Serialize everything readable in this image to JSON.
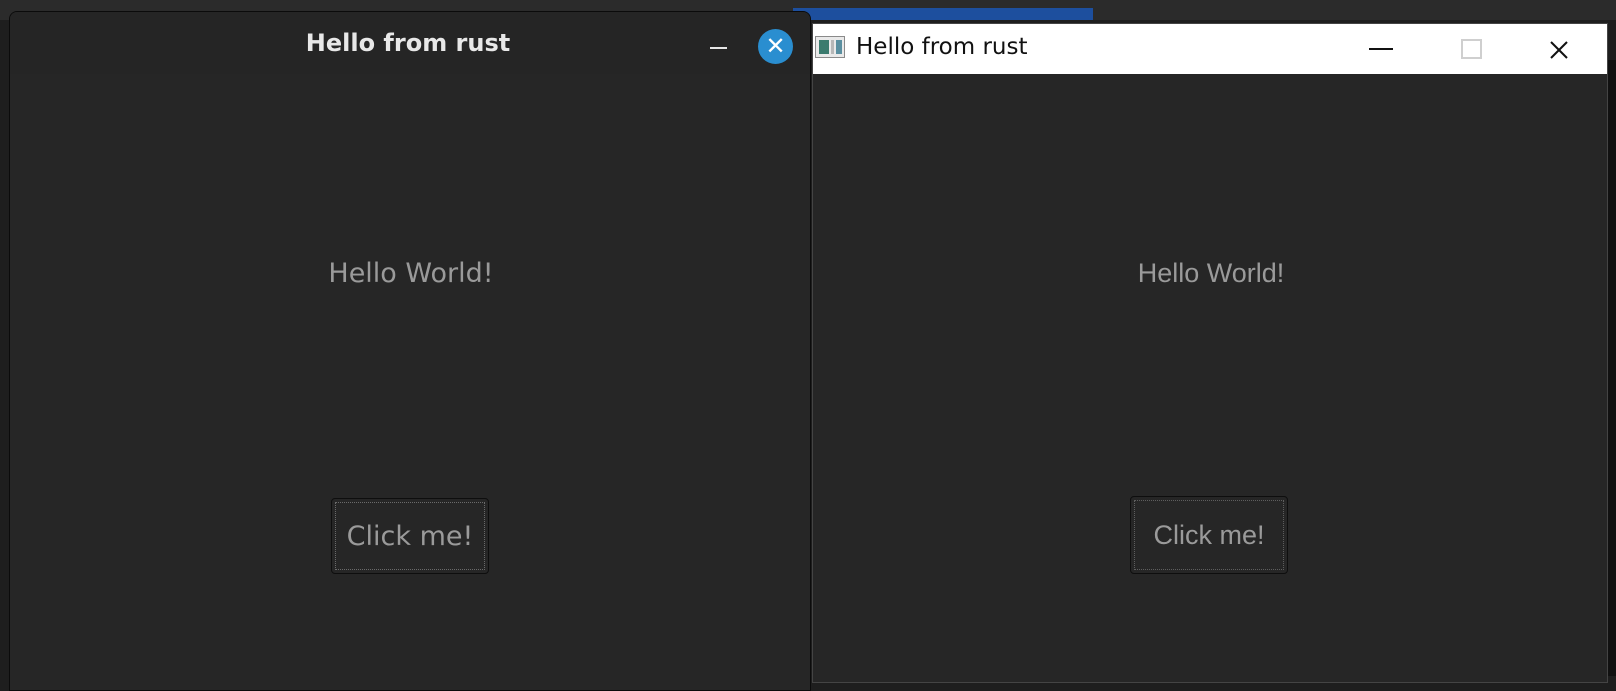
{
  "linux_window": {
    "title": "Hello from rust",
    "label": "Hello World!",
    "button_label": "Click me!",
    "icons": {
      "minimize": "minimize-icon",
      "close": "close-icon"
    },
    "colors": {
      "close_button": "#2a8ed0",
      "background": "#262626"
    }
  },
  "windows_window": {
    "title": "Hello from rust",
    "label": "Hello World!",
    "button_label": "Click me!",
    "icons": {
      "app": "app-icon",
      "minimize": "minimize-icon",
      "maximize": "maximize-icon",
      "close": "close-icon"
    },
    "colors": {
      "titlebar": "#ffffff",
      "background": "#262626"
    }
  }
}
